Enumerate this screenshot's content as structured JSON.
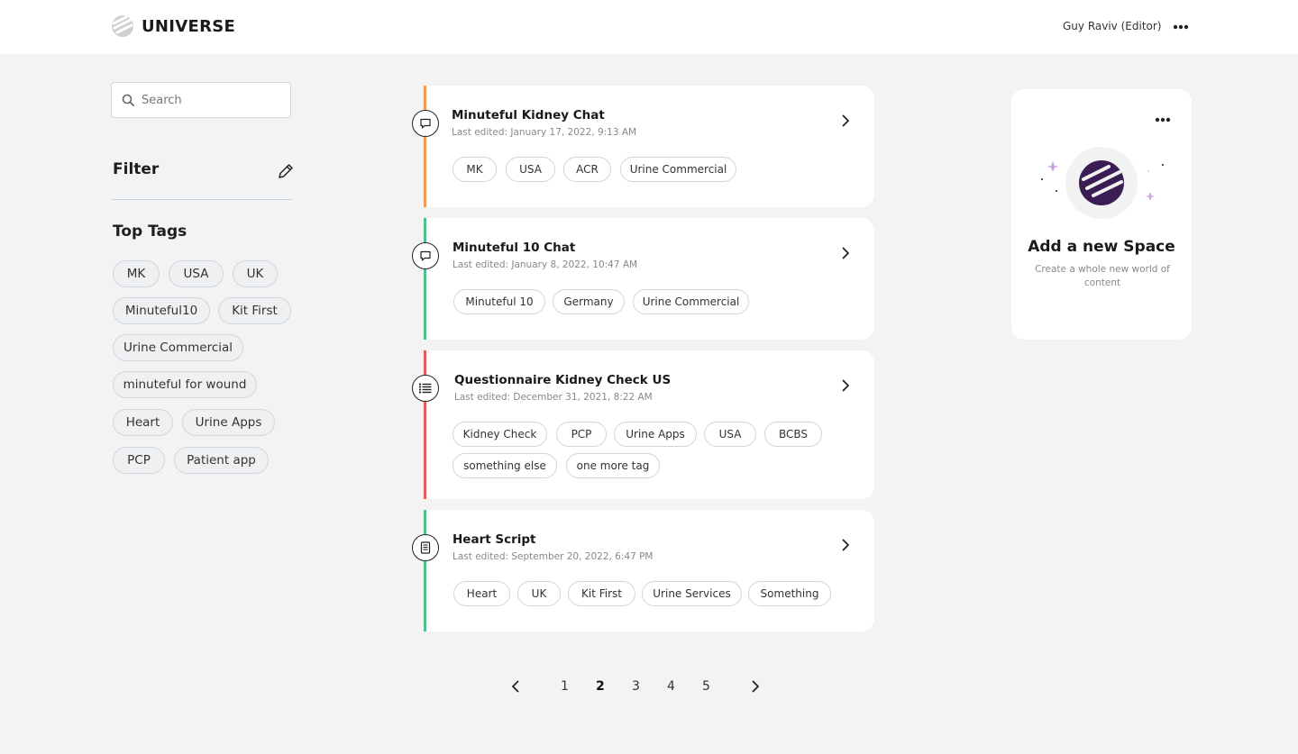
{
  "app": {
    "name": "UNIVERSE",
    "user": "Guy Raviv (Editor)"
  },
  "sidebar": {
    "search_placeholder": "Search",
    "filter_title": "Filter",
    "top_tags_title": "Top Tags",
    "tags": [
      "MK",
      "USA",
      "UK",
      "Minuteful10",
      "Kit First",
      "Urine Commercial",
      "minuteful for wound",
      "Heart",
      "Urine Apps",
      "PCP",
      "Patient app"
    ]
  },
  "cards": [
    {
      "title": "Minuteful Kidney Chat",
      "date": "Last edited: January 17, 2022, 9:13 AM",
      "icon": "chat-icon",
      "accent": "#f39a57",
      "tags": [
        "MK",
        "USA",
        "ACR",
        "Urine Commercial"
      ]
    },
    {
      "title": "Minuteful 10 Chat",
      "date": "Last edited: January 8, 2022, 10:47 AM",
      "icon": "chat-icon",
      "accent": "#4fbf8b",
      "tags": [
        "Minuteful 10",
        "Germany",
        "Urine Commercial"
      ]
    },
    {
      "title": "Questionnaire Kidney Check US",
      "date": "Last edited: December 31, 2021, 8:22 AM",
      "icon": "list-icon",
      "accent": "#e25c5c",
      "tags": [
        "Kidney Check",
        "PCP",
        "Urine Apps",
        "USA",
        "BCBS",
        "something else",
        "one more tag"
      ]
    },
    {
      "title": "Heart Script",
      "date": "Last edited: September 20, 2022, 6:47 PM",
      "icon": "document-icon",
      "accent": "#4fbf8b",
      "tags": [
        "Heart",
        "UK",
        "Kit First",
        "Urine Services",
        "Something"
      ]
    }
  ],
  "pagination": {
    "pages": [
      "1",
      "2",
      "3",
      "4",
      "5"
    ],
    "current": "2"
  },
  "new_space": {
    "title": "Add a new Space",
    "subtitle": "Create a whole new world of content"
  }
}
